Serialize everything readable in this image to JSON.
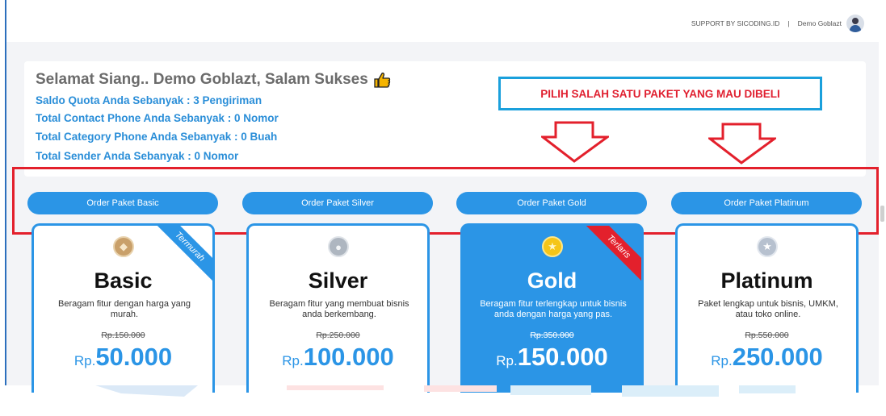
{
  "header": {
    "support_text": "SUPPORT BY SICODING.ID",
    "separator": "|",
    "username": "Demo Goblazt"
  },
  "welcome": {
    "title": "Selamat Siang.. Demo Goblazt, Salam Sukses",
    "thumb_icon": "thumbs-up-icon",
    "stats": [
      "Saldo Quota Anda Sebanyak : 3 Pengiriman",
      "Total Contact Phone Anda Sebanyak : 0 Nomor",
      "Total Category Phone Anda Sebanyak : 0 Buah",
      "Total Sender Anda Sebanyak : 0 Nomor"
    ]
  },
  "callout": {
    "text": "PILIH SALAH SATU PAKET YANG MAU DIBELI"
  },
  "orders": [
    "Order Paket Basic",
    "Order Paket Silver",
    "Order Paket Gold",
    "Order Paket Platinum"
  ],
  "plans": [
    {
      "name": "Basic",
      "desc": "Beragam fitur dengan harga yang murah.",
      "old_price": "Rp.150.000",
      "currency": "Rp.",
      "price": "50.000",
      "ribbon": "Termurah",
      "medal": "bronze-medal-icon"
    },
    {
      "name": "Silver",
      "desc": "Beragam fitur yang membuat bisnis anda berkembang.",
      "old_price": "Rp.250.000",
      "currency": "Rp.",
      "price": "100.000",
      "ribbon": "",
      "medal": "silver-medal-icon"
    },
    {
      "name": "Gold",
      "desc": "Beragam fitur terlengkap untuk bisnis anda dengan harga yang pas.",
      "old_price": "Rp.350.000",
      "currency": "Rp.",
      "price": "150.000",
      "ribbon": "Terlaris",
      "medal": "gold-medal-icon"
    },
    {
      "name": "Platinum",
      "desc": "Paket lengkap untuk bisnis, UMKM, atau toko online.",
      "old_price": "Rp.550.000",
      "currency": "Rp.",
      "price": "250.000",
      "ribbon": "",
      "medal": "platinum-medal-icon"
    }
  ],
  "colors": {
    "accent": "#2b95e6",
    "annotation_red": "#e3202c",
    "callout_border": "#1aa0dc",
    "bronze": "#c9a06a",
    "silver": "#aeb6c0",
    "gold": "#f5c518",
    "platinum": "#b7c1cf"
  }
}
